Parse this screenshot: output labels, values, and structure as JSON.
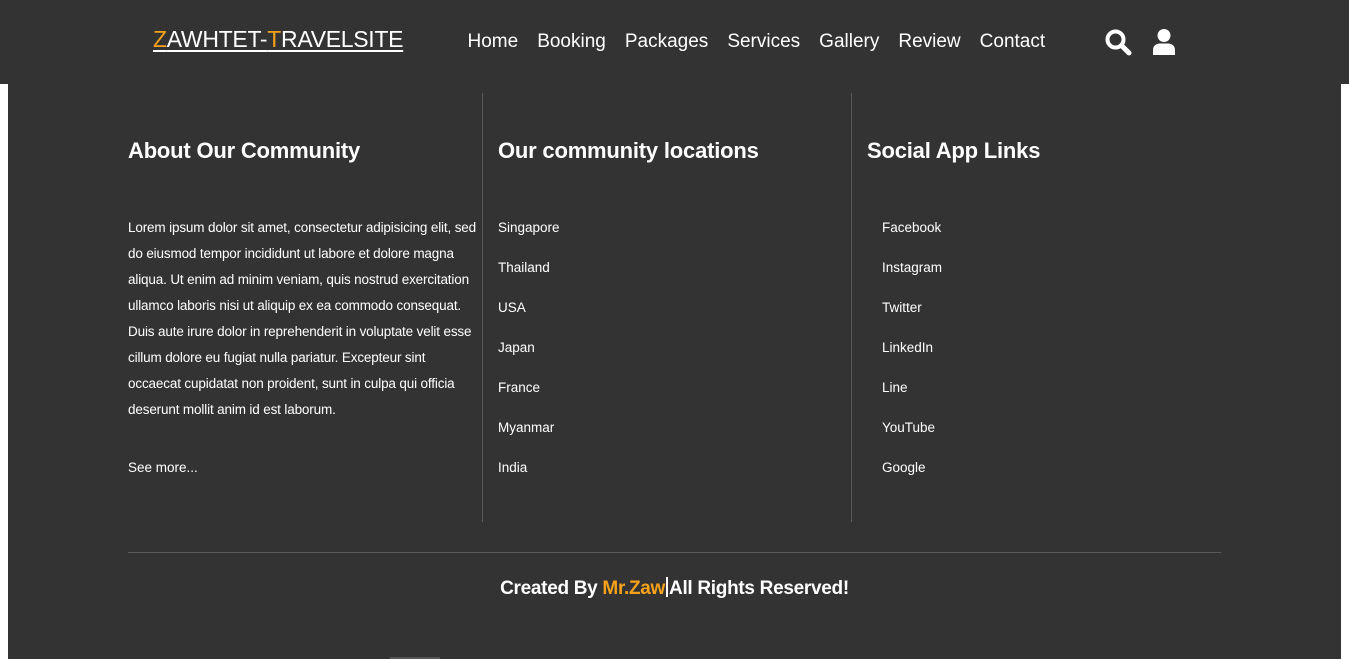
{
  "header": {
    "logo": {
      "letter_first": "Z",
      "part1": "AWHTET-",
      "letter_second": "T",
      "part2": "RAVELSITE"
    },
    "nav": [
      "Home",
      "Booking",
      "Packages",
      "Services",
      "Gallery",
      "Review",
      "Contact"
    ],
    "icons": [
      "search-icon",
      "user-icon"
    ]
  },
  "footer": {
    "about": {
      "title": "About Our Community",
      "text": "Lorem ipsum dolor sit amet, consectetur adipisicing elit, sed do eiusmod tempor incididunt ut labore et dolore magna aliqua. Ut enim ad minim veniam, quis nostrud exercitation ullamco laboris nisi ut aliquip ex ea commodo consequat. Duis aute irure dolor in reprehenderit in voluptate velit esse cillum dolore eu fugiat nulla pariatur. Excepteur sint occaecat cupidatat non proident, sunt in culpa qui officia deserunt mollit anim id est laborum.",
      "more": "See more..."
    },
    "locations": {
      "title": "Our community locations",
      "items": [
        "Singapore",
        "Thailand",
        "USA",
        "Japan",
        "France",
        "Myanmar",
        "India"
      ]
    },
    "social": {
      "title": "Social App Links",
      "items": [
        "Facebook",
        "Instagram",
        "Twitter",
        "LinkedIn",
        "Line",
        "YouTube",
        "Google"
      ]
    },
    "credit": {
      "prefix": "Created By ",
      "author": "Mr.Zaw",
      "suffix": "All Rights Reserved!"
    }
  },
  "colors": {
    "background": "#333333",
    "accent": "#f5a21a",
    "text": "#ffffff"
  }
}
